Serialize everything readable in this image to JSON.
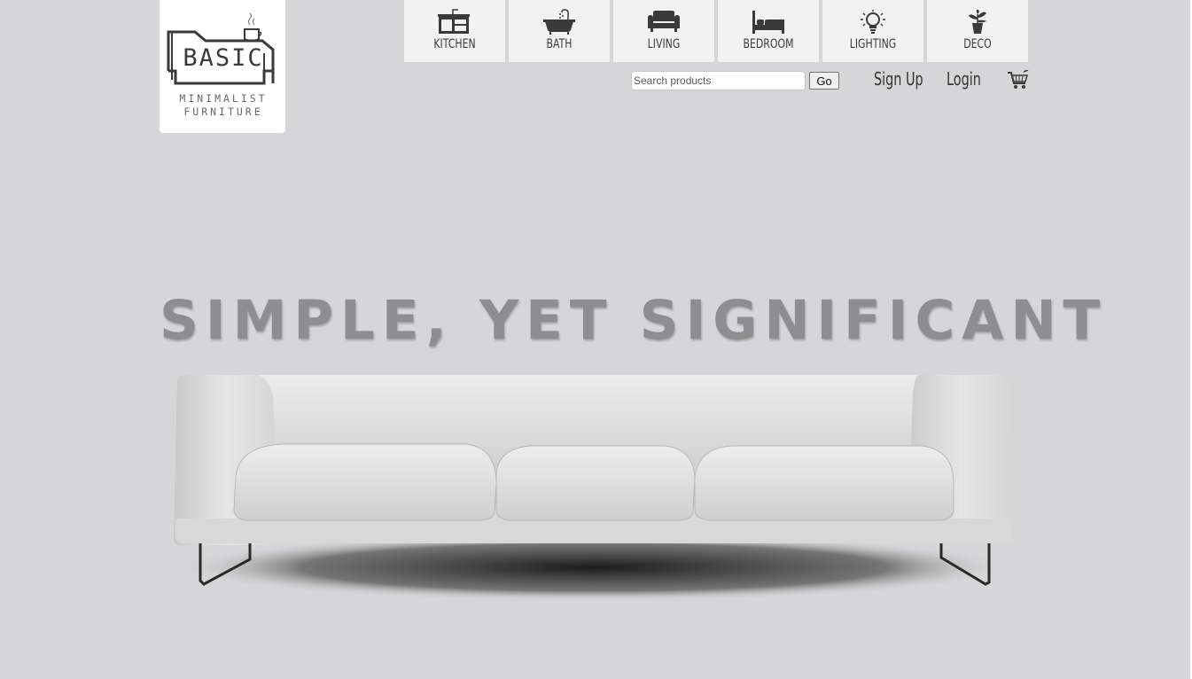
{
  "logo": {
    "word": "BASIC",
    "tagline_line1": "MINIMALIST",
    "tagline_line2": "FURNITURE"
  },
  "nav": {
    "items": [
      {
        "label": "KITCHEN",
        "icon": "kitchen-icon"
      },
      {
        "label": "BATH",
        "icon": "bathtub-icon"
      },
      {
        "label": "LIVING",
        "icon": "armchair-icon"
      },
      {
        "label": "BEDROOM",
        "icon": "bed-icon"
      },
      {
        "label": "LIGHTING",
        "icon": "lightbulb-icon"
      },
      {
        "label": "DECO",
        "icon": "plant-icon"
      }
    ]
  },
  "search": {
    "placeholder": "Search products",
    "value": "",
    "button_label": "Go"
  },
  "account": {
    "signup_label": "Sign Up",
    "login_label": "Login",
    "cart_icon": "cart-icon"
  },
  "hero": {
    "title": "SIMPLE, YET SIGNIFICANT",
    "image": "sofa-image"
  },
  "colors": {
    "background": "#d6d6d8",
    "tile": "#f2f2f3",
    "text_dark": "#3a3a3a",
    "hero_text": "#8e8e90"
  }
}
